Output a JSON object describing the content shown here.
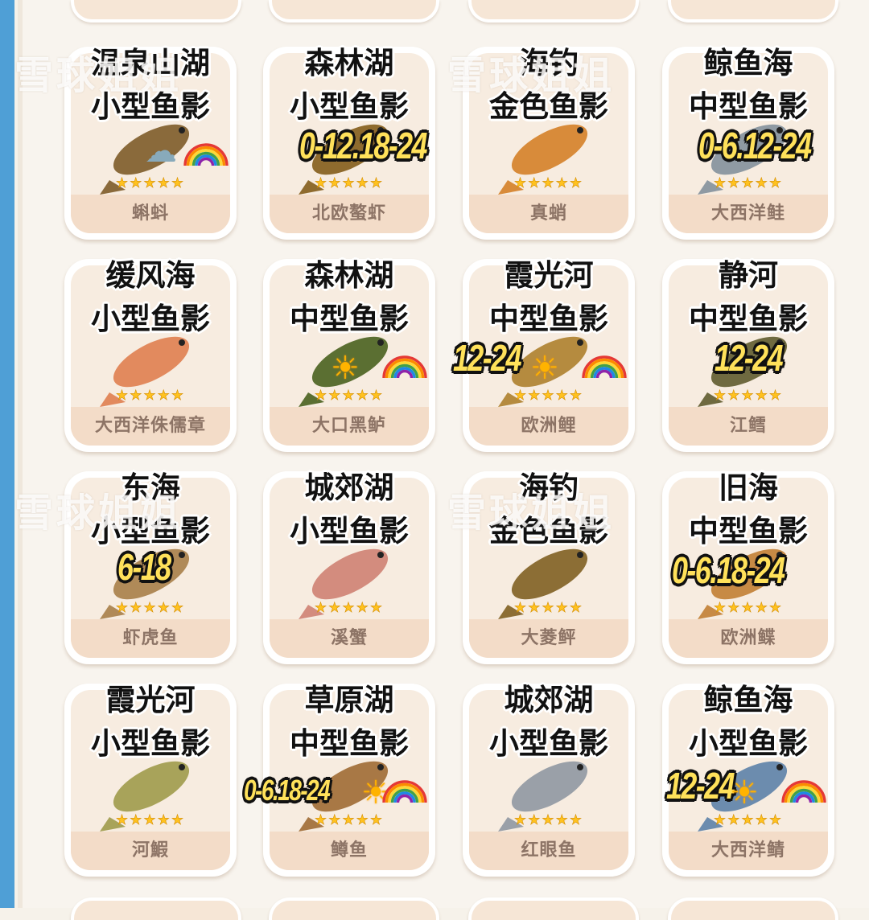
{
  "watermark": "雪球姐姐",
  "cards": [
    {
      "location": "温泉山湖",
      "shadow": "小型鱼影",
      "time": "",
      "weather": [
        "雨",
        "彩虹"
      ],
      "stars": "★★★★★",
      "name": "蝌蚪",
      "fish_icon": "tadpole-icon"
    },
    {
      "location": "森林湖",
      "shadow": "小型鱼影",
      "time": "0-12.18-24",
      "weather": [],
      "stars": "★★★★★",
      "name": "北欧螯虾",
      "fish_icon": "crayfish-icon"
    },
    {
      "location": "海钓",
      "shadow": "金色鱼影",
      "time": "",
      "weather": [],
      "stars": "★★★★★",
      "name": "真蛸",
      "fish_icon": "octopus-icon"
    },
    {
      "location": "鲸鱼海",
      "shadow": "中型鱼影",
      "time": "0-6.12-24",
      "weather": [],
      "stars": "★★★★★",
      "name": "大西洋鲑",
      "fish_icon": "salmon-icon"
    },
    {
      "location": "缓风海",
      "shadow": "小型鱼影",
      "time": "",
      "weather": [],
      "stars": "★★★★★",
      "name": "大西洋侏儒章",
      "fish_icon": "pygmy-octopus-icon"
    },
    {
      "location": "森林湖",
      "shadow": "中型鱼影",
      "time": "",
      "weather": [
        "晴",
        "彩虹"
      ],
      "stars": "★★★★★",
      "name": "大口黑鲈",
      "fish_icon": "bass-icon"
    },
    {
      "location": "霞光河",
      "shadow": "中型鱼影",
      "time": "12-24",
      "weather": [
        "晴",
        "彩虹"
      ],
      "stars": "★★★★★",
      "name": "欧洲鲤",
      "fish_icon": "carp-icon"
    },
    {
      "location": "静河",
      "shadow": "中型鱼影",
      "time": "12-24",
      "weather": [],
      "stars": "★★★★★",
      "name": "江鳕",
      "fish_icon": "burbot-icon"
    },
    {
      "location": "东海",
      "shadow": "小型鱼影",
      "time": "6-18",
      "weather": [],
      "stars": "★★★★★",
      "name": "虾虎鱼",
      "fish_icon": "goby-icon"
    },
    {
      "location": "城郊湖",
      "shadow": "小型鱼影",
      "time": "",
      "weather": [],
      "stars": "★★★★★",
      "name": "溪蟹",
      "fish_icon": "crab-icon"
    },
    {
      "location": "海钓",
      "shadow": "金色鱼影",
      "time": "",
      "weather": [],
      "stars": "★★★★★",
      "name": "大菱鲆",
      "fish_icon": "turbot-icon"
    },
    {
      "location": "旧海",
      "shadow": "中型鱼影",
      "time": "0-6.18-24",
      "weather": [],
      "stars": "★★★★★",
      "name": "欧洲鲽",
      "fish_icon": "plaice-icon"
    },
    {
      "location": "霞光河",
      "shadow": "小型鱼影",
      "time": "",
      "weather": [],
      "stars": "★★★★★",
      "name": "河鰕",
      "fish_icon": "river-goby-icon"
    },
    {
      "location": "草原湖",
      "shadow": "中型鱼影",
      "time": "0-6.18-24",
      "weather": [
        "晴",
        "彩虹"
      ],
      "stars": "★★★★★",
      "name": "鳟鱼",
      "fish_icon": "trout-icon"
    },
    {
      "location": "城郊湖",
      "shadow": "小型鱼影",
      "time": "",
      "weather": [],
      "stars": "★★★★★",
      "name": "红眼鱼",
      "fish_icon": "rudd-icon"
    },
    {
      "location": "鲸鱼海",
      "shadow": "小型鱼影",
      "time": "12-24",
      "weather": [
        "晴",
        "彩虹"
      ],
      "stars": "★★★★★",
      "name": "大西洋鲭",
      "fish_icon": "mackerel-icon"
    }
  ]
}
